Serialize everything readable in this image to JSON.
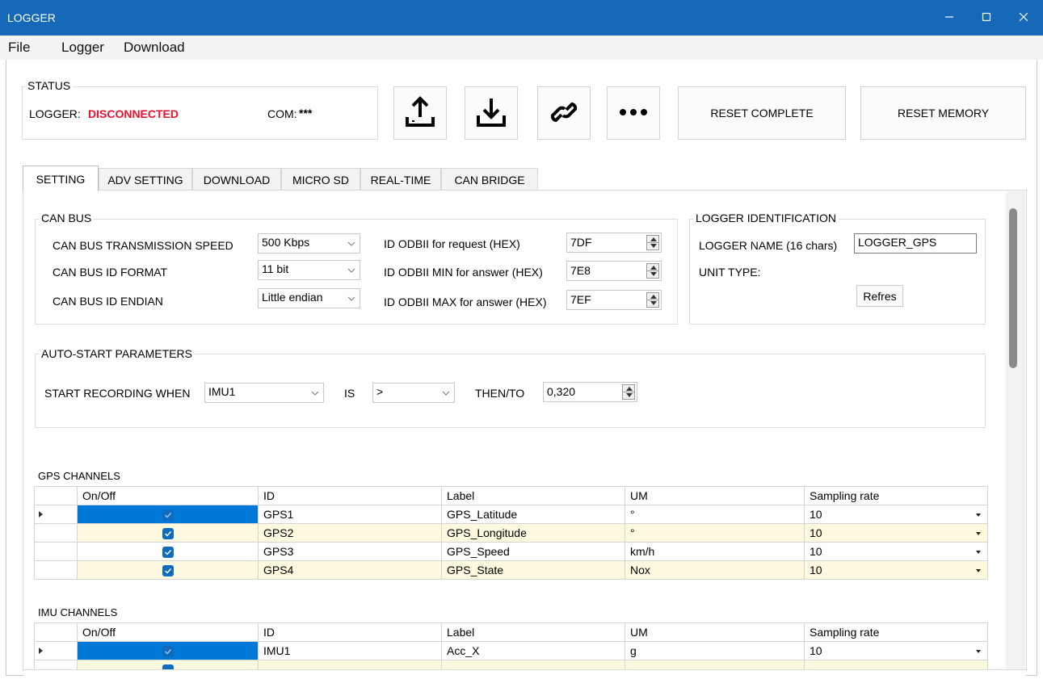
{
  "window": {
    "title": "LOGGER"
  },
  "menu": [
    "File",
    "Logger",
    "Download"
  ],
  "status": {
    "legend": "STATUS",
    "logger_label": "LOGGER:",
    "logger_value": "DISCONNECTED",
    "com_label": "COM:",
    "com_value": "***"
  },
  "toolbar": {
    "upload_icon": "upload-icon",
    "download_icon": "download-icon",
    "link_icon": "link-icon",
    "more_icon": "more-icon",
    "reset_complete": "RESET COMPLETE",
    "reset_memory": "RESET MEMORY"
  },
  "tabs": [
    "SETTING",
    "ADV SETTING",
    "DOWNLOAD",
    "MICRO SD",
    "REAL-TIME",
    "CAN BRIDGE"
  ],
  "can_bus": {
    "legend": "CAN BUS",
    "speed_label": "CAN BUS TRANSMISSION SPEED",
    "speed_value": "500 Kbps",
    "format_label": "CAN BUS ID FORMAT",
    "format_value": "11 bit",
    "endian_label": "CAN BUS ID ENDIAN",
    "endian_value": "Little endian",
    "req_label": "ID ODBII for request (HEX)",
    "req_value": "7DF",
    "min_label": "ID ODBII MIN for answer (HEX)",
    "min_value": "7E8",
    "max_label": "ID ODBII MAX for answer (HEX)",
    "max_value": "7EF"
  },
  "logger_id": {
    "legend": "LOGGER IDENTIFICATION",
    "name_label": "LOGGER NAME (16 chars)",
    "name_value": "LOGGER_GPS",
    "unit_label": "UNIT TYPE:",
    "refresh": "Refres"
  },
  "autostart": {
    "legend": "AUTO-START PARAMETERS",
    "start_label": "START RECORDING WHEN",
    "channel_value": "IMU1",
    "is_label": "IS",
    "op_value": ">",
    "then_label": "THEN/TO",
    "threshold_value": "0,320"
  },
  "gps": {
    "title": "GPS CHANNELS",
    "columns": [
      "On/Off",
      "ID",
      "Label",
      "UM",
      "Sampling rate"
    ],
    "rows": [
      {
        "id": "GPS1",
        "label": "GPS_Latitude",
        "um": "°",
        "rate": "10"
      },
      {
        "id": "GPS2",
        "label": "GPS_Longitude",
        "um": "°",
        "rate": "10"
      },
      {
        "id": "GPS3",
        "label": "GPS_Speed",
        "um": "km/h",
        "rate": "10"
      },
      {
        "id": "GPS4",
        "label": "GPS_State",
        "um": "Nox",
        "rate": "10"
      }
    ]
  },
  "imu": {
    "title": "IMU CHANNELS",
    "columns": [
      "On/Off",
      "ID",
      "Label",
      "UM",
      "Sampling rate"
    ],
    "rows": [
      {
        "id": "IMU1",
        "label": "Acc_X",
        "um": "g",
        "rate": "10"
      }
    ]
  },
  "colors": {
    "titlebar": "#1669b9",
    "disconnected": "#e8112d",
    "selection": "#0078d7",
    "alt_row": "#fdf9de"
  }
}
